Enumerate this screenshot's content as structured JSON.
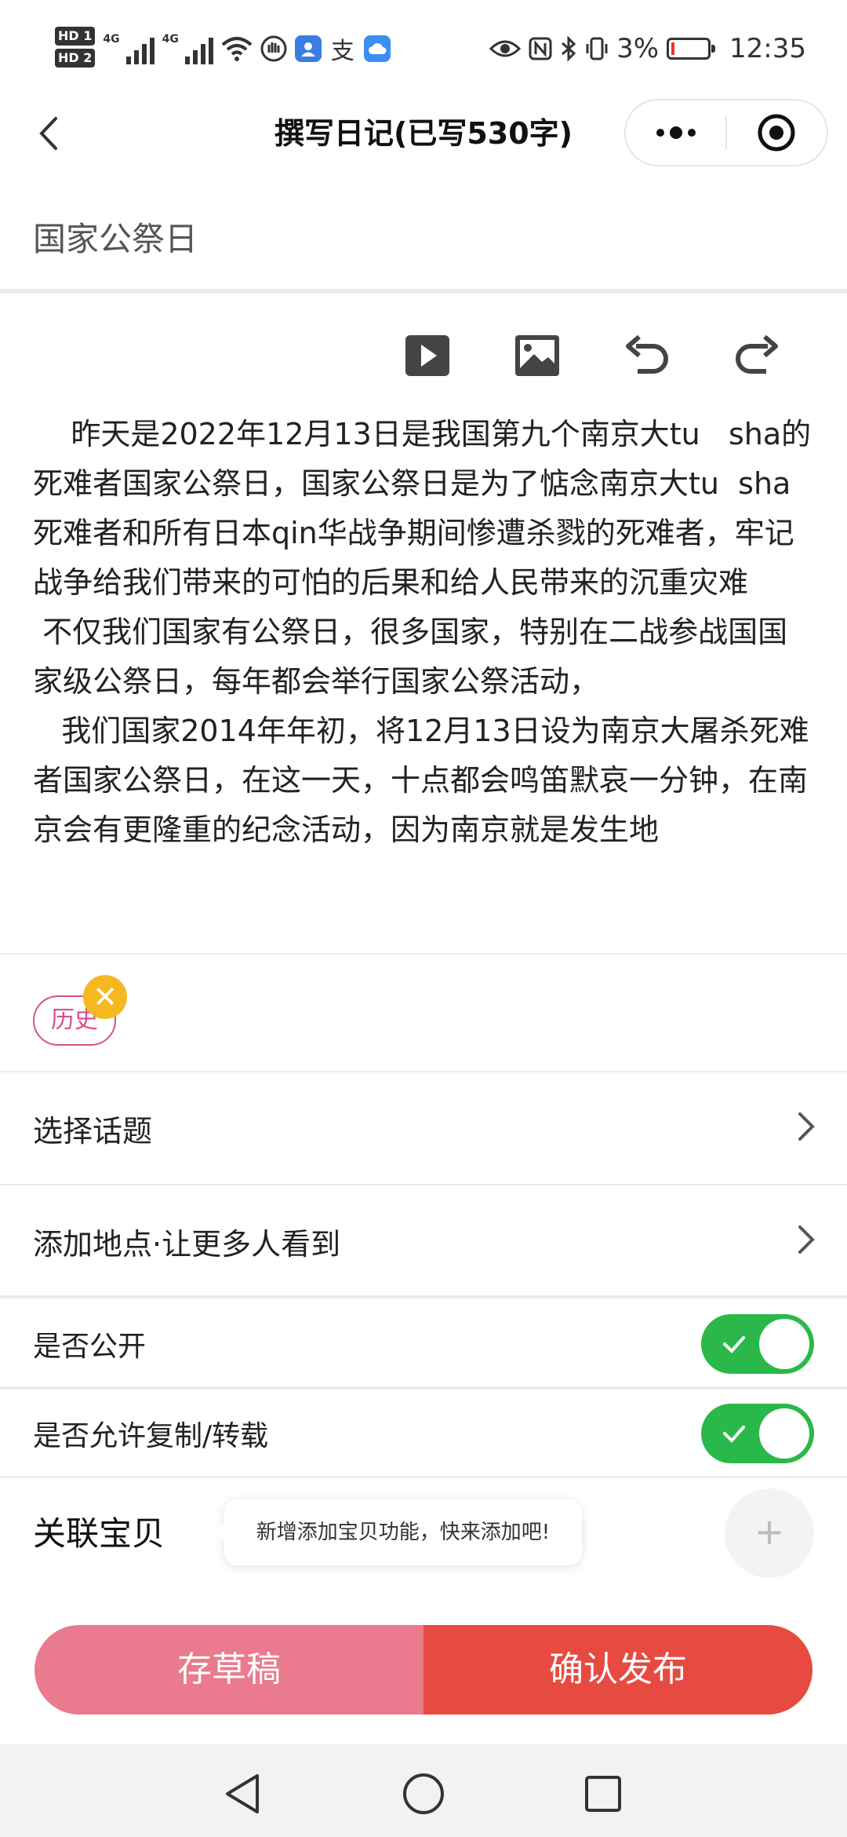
{
  "status_bar": {
    "hd1": "HD 1",
    "hd2": "HD 2",
    "network1": "4G",
    "network2": "4G",
    "battery_text": "3%",
    "time": "12:35",
    "pay_app_glyph": "支"
  },
  "nav": {
    "title": "撰写日记(已写530字)"
  },
  "diary": {
    "title": "国家公祭日",
    "body": "    昨天是2022年12月13日是我国第九个南京大tu   sha的死难者国家公祭日，国家公祭日是为了惦念南京大tu  sha 死难者和所有日本qin华战争期间惨遭杀戮的死难者，牢记战争给我们带来的可怕的后果和给人民带来的沉重灾难\n 不仅我们国家有公祭日，很多国家，特别在二战参战国国家级公祭日，每年都会举行国家公祭活动，\n   我们国家2014年年初，将12月13日设为南京大屠杀死难者国家公祭日，在这一天，十点都会鸣笛默哀一分钟，在南京会有更隆重的纪念活动，因为南京就是发生地"
  },
  "tags": [
    {
      "label": "历史",
      "remove_glyph": "✕"
    }
  ],
  "rows": {
    "topic": "选择话题",
    "location": "添加地点·让更多人看到",
    "public": "是否公开",
    "allow_copy": "是否允许复制/转载"
  },
  "toggles": {
    "public_on": true,
    "allow_copy_on": true
  },
  "related": {
    "label": "关联宝贝",
    "tip": "新增添加宝贝功能，快来添加吧!",
    "add_glyph": "+"
  },
  "buttons": {
    "draft": "存草稿",
    "publish": "确认发布"
  },
  "colors": {
    "toggle_on": "#2bb84a",
    "draft": "#ea7a8d",
    "publish": "#e64a41",
    "tag": "#d84f8c",
    "tag_close": "#f6b81f"
  }
}
